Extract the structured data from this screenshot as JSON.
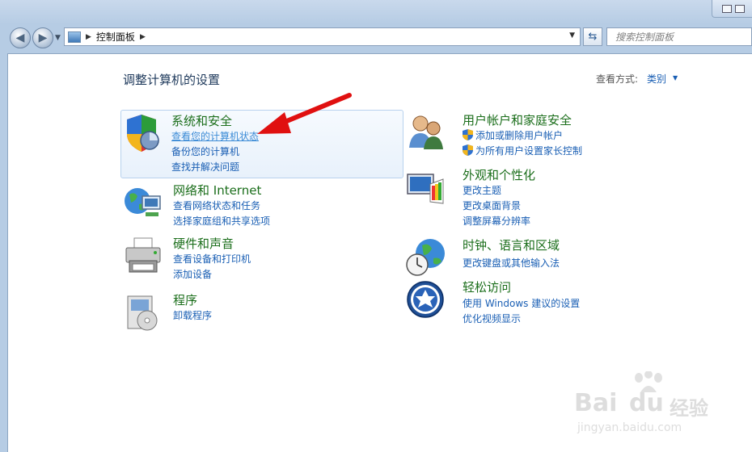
{
  "window": {
    "address_path": "控制面板",
    "search_placeholder": "搜索控制面板"
  },
  "header": {
    "title": "调整计算机的设置",
    "view_by_label": "查看方式:",
    "view_by_value": "类别"
  },
  "left_categories": [
    {
      "title": "系统和安全",
      "icon": "security-shield-icon",
      "links": [
        "查看您的计算机状态",
        "备份您的计算机",
        "查找并解决问题"
      ]
    },
    {
      "title": "网络和 Internet",
      "icon": "network-globe-icon",
      "links": [
        "查看网络状态和任务",
        "选择家庭组和共享选项"
      ]
    },
    {
      "title": "硬件和声音",
      "icon": "printer-icon",
      "links": [
        "查看设备和打印机",
        "添加设备"
      ]
    },
    {
      "title": "程序",
      "icon": "programs-box-icon",
      "links": [
        "卸载程序"
      ]
    }
  ],
  "right_categories": [
    {
      "title": "用户帐户和家庭安全",
      "icon": "users-icon",
      "links": [
        "添加或删除用户帐户",
        "为所有用户设置家长控制"
      ]
    },
    {
      "title": "外观和个性化",
      "icon": "monitor-palette-icon",
      "links": [
        "更改主题",
        "更改桌面背景",
        "调整屏幕分辨率"
      ]
    },
    {
      "title": "时钟、语言和区域",
      "icon": "globe-clock-icon",
      "links": [
        "更改键盘或其他输入法"
      ]
    },
    {
      "title": "轻松访问",
      "icon": "ease-of-access-icon",
      "links": [
        "使用 Windows 建议的设置",
        "优化视频显示"
      ]
    }
  ],
  "watermark": {
    "brand": "Bai",
    "brand2": "du",
    "suffix": "经验",
    "url": "jingyan.baidu.com"
  },
  "colors": {
    "category_title": "#1b6e1b",
    "link": "#1a5fb4",
    "annotation_arrow": "#e01010"
  }
}
